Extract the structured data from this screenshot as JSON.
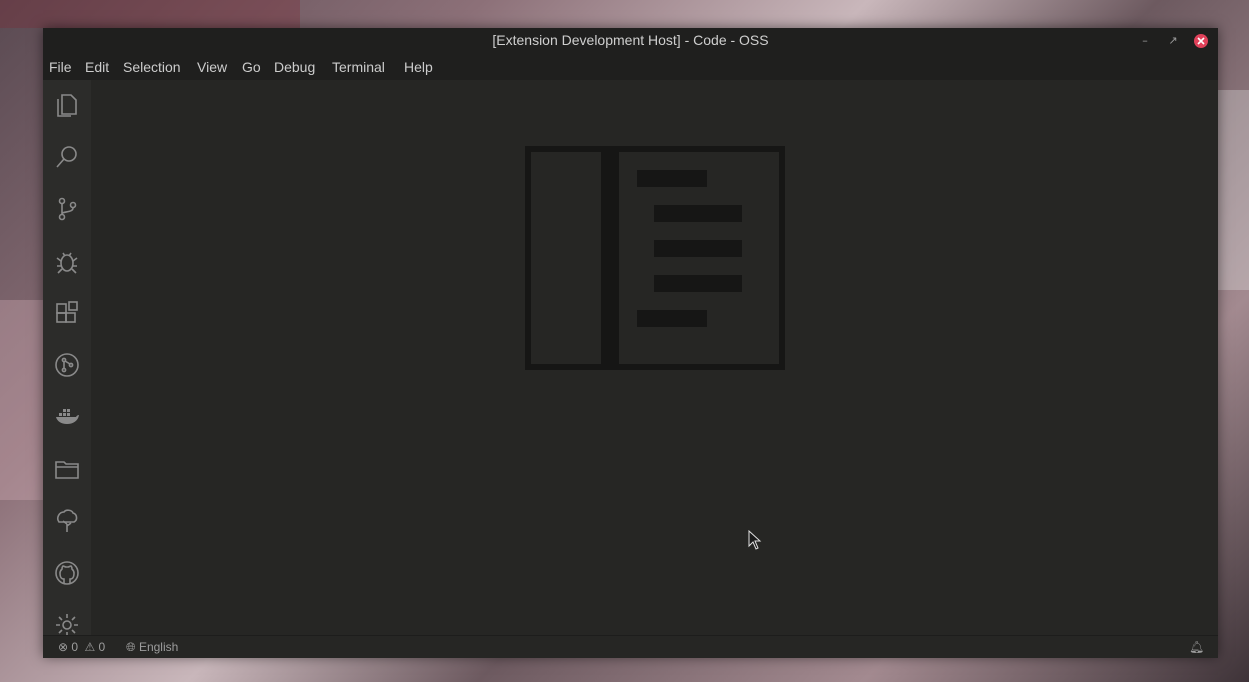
{
  "window": {
    "title": "[Extension Development Host] - Code - OSS",
    "controls": [
      "minimize-icon",
      "maximize-icon",
      "close-icon"
    ]
  },
  "menu": {
    "items": [
      "File",
      "Edit",
      "Selection",
      "View",
      "Go",
      "Debug",
      "Terminal",
      "Help"
    ]
  },
  "activitybar": {
    "icons": [
      "files-icon",
      "search-icon",
      "source-control-icon",
      "debug-icon",
      "extensions-icon",
      "git-graph-icon",
      "docker-icon",
      "folder-icon",
      "tree-icon",
      "github-icon",
      "settings-gear-icon"
    ]
  },
  "status": {
    "errors": "0",
    "warnings": "0",
    "language": "English"
  },
  "colors": {
    "accent_close": "#e0415a",
    "editor_bg": "#262624",
    "chrome_bg": "#1f1f1e"
  }
}
